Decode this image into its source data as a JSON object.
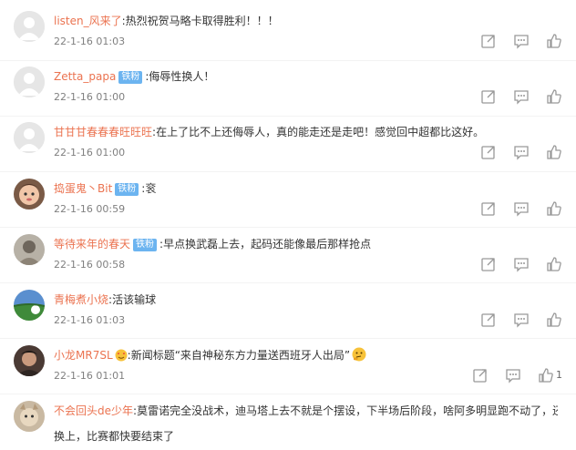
{
  "accent_colors": {
    "username": "#eb7350",
    "badge": "#6cb4f0",
    "time": "#808080"
  },
  "comments": [
    {
      "user": "listen_风来了",
      "badge": "",
      "text": "热烈祝贺马略卡取得胜利！！！",
      "time": "22-1-16 01:03",
      "likes": ""
    },
    {
      "user": "Zetta_papa",
      "badge": "铁粉",
      "text": "侮辱性换人！",
      "time": "22-1-16 01:00",
      "likes": ""
    },
    {
      "user": "甘甘甘春春春旺旺旺",
      "badge": "",
      "text": "在上了比不上还侮辱人，真的能走还是走吧！感觉回中超都比这好。",
      "time": "22-1-16 01:00",
      "likes": ""
    },
    {
      "user": "捣蛋鬼丶Bit",
      "badge": "铁粉",
      "text": "衮",
      "time": "22-1-16 00:59",
      "likes": ""
    },
    {
      "user": "等待来年的春天",
      "badge": "铁粉",
      "text": "早点换武磊上去，起码还能像最后那样抢点",
      "time": "22-1-16 00:58",
      "likes": ""
    },
    {
      "user": "青梅煮小烧",
      "badge": "",
      "text": "活该输球",
      "time": "22-1-16 01:03",
      "likes": ""
    },
    {
      "user": "小龙MR7SL",
      "badge": "",
      "text": "新闻标题“来自神秘东方力量送西班牙人出局”",
      "time": "22-1-16 01:01",
      "likes": "1"
    },
    {
      "user": "不会回头de少年",
      "badge": "",
      "text": "莫雷诺完全没战术，迪马塔上去不就是个摆设，下半场后阶段，啥阿多明显跑不动了，还不",
      "time": "",
      "likes": ""
    }
  ],
  "overflow_text": "换上，比赛都快要结束了",
  "icons": {
    "repost": "repost-icon",
    "comment": "comment-icon",
    "like": "thumbs-up-icon"
  }
}
